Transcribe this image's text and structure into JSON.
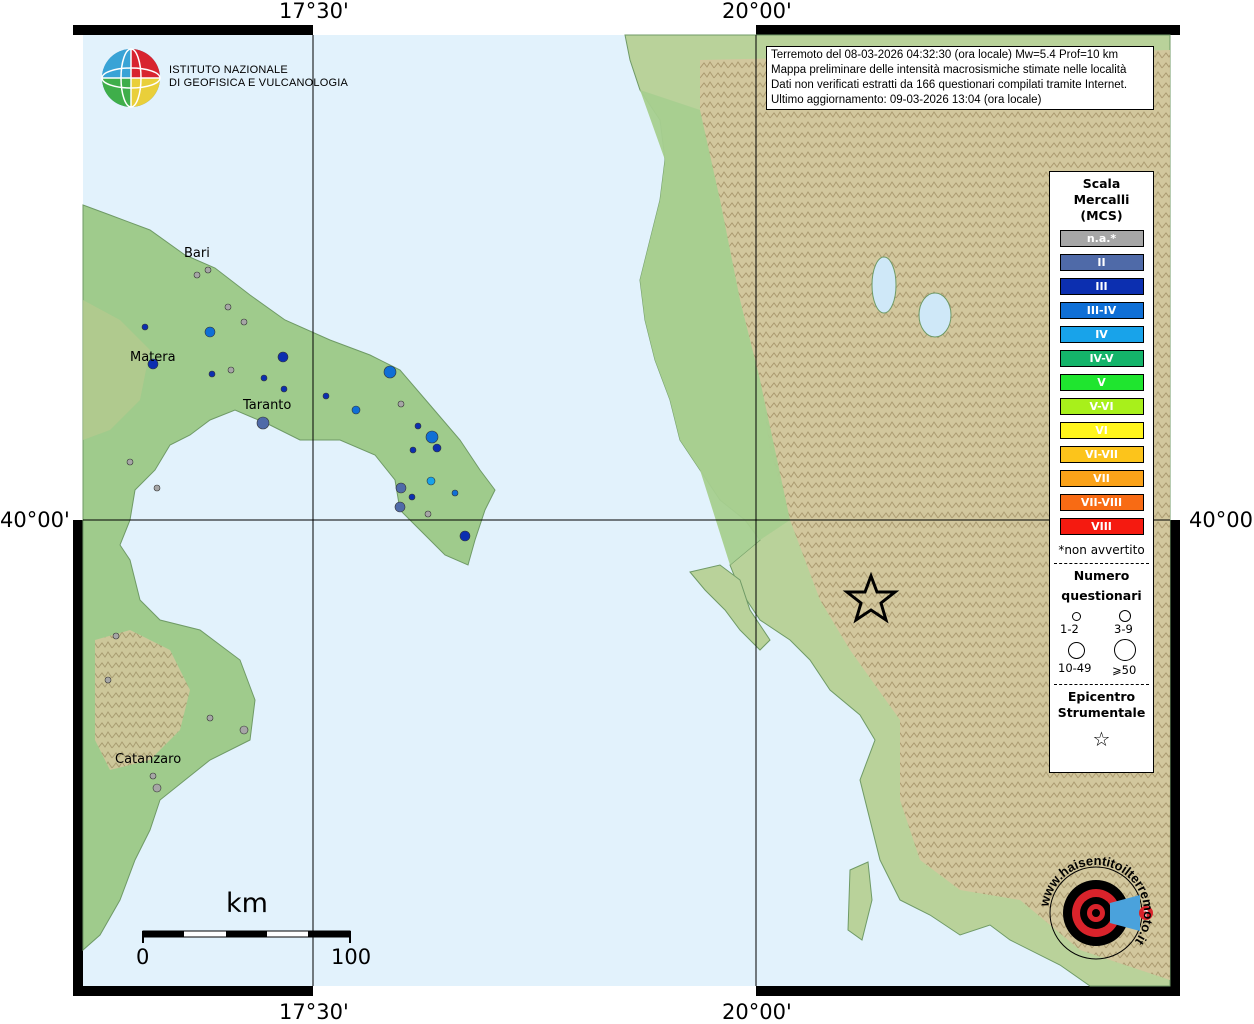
{
  "map": {
    "grid_labels": {
      "lon_left": "17°30'",
      "lon_right": "20°00'",
      "lat": "40°00'"
    },
    "cities": [
      "Bari",
      "Matera",
      "Taranto",
      "Catanzaro"
    ]
  },
  "institute": {
    "line1": "ISTITUTO NAZIONALE",
    "line2": "DI GEOFISICA E VULCANOLOGIA"
  },
  "info": {
    "line1": "Terremoto del 08-03-2026 04:32:30 (ora locale) Mw=5.4 Prof=10 km",
    "line2": "Mappa preliminare delle intensità macrosismiche stimate nelle località",
    "line3": "Dati non verificati estratti da 166 questionari compilati tramite Internet.",
    "line4": "Ultimo aggiornamento: 09-03-2026 13:04 (ora locale)"
  },
  "legend": {
    "title1": "Scala",
    "title2": "Mercalli",
    "title3": "(MCS)",
    "classes": [
      {
        "label": "n.a.*",
        "color": "#a6a6a6"
      },
      {
        "label": "II",
        "color": "#4f6aa8"
      },
      {
        "label": "III",
        "color": "#0c2fb0"
      },
      {
        "label": "III-IV",
        "color": "#0f6fd6"
      },
      {
        "label": "IV",
        "color": "#18a3ea"
      },
      {
        "label": "IV-V",
        "color": "#14b46a"
      },
      {
        "label": "V",
        "color": "#1fe52f"
      },
      {
        "label": "V-VI",
        "color": "#a8f01b"
      },
      {
        "label": "VI",
        "color": "#fff51c"
      },
      {
        "label": "VI-VII",
        "color": "#fcc41b"
      },
      {
        "label": "VII",
        "color": "#fba219"
      },
      {
        "label": "VII-VIII",
        "color": "#f86b14"
      },
      {
        "label": "VIII",
        "color": "#f51a10"
      }
    ],
    "note": "*non avvertito",
    "count_title1": "Numero",
    "count_title2": "questionari",
    "sizes": [
      "1-2",
      "3-9",
      "10-49",
      "⩾50"
    ],
    "epicenter1": "Epicentro",
    "epicenter2": "Strumentale",
    "star": "☆"
  },
  "scale_bar": {
    "unit": "km",
    "start": "0",
    "end": "100"
  },
  "badge": {
    "text": "www.haisentitoilterremoto.it"
  }
}
